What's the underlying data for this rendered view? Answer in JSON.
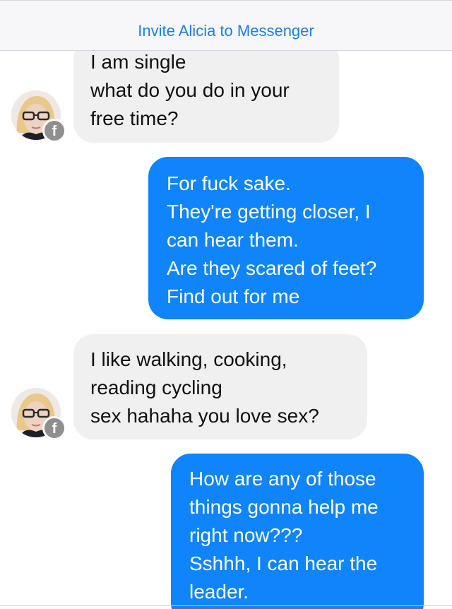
{
  "header": {
    "invite_label": "Invite Alicia to Messenger"
  },
  "messages": [
    {
      "sender": "Alicia",
      "direction": "incoming",
      "lines": [
        "I am single",
        "what do you do in your",
        "free time?"
      ]
    },
    {
      "direction": "outgoing",
      "lines": [
        "For fuck sake.",
        "They're getting closer, I",
        "can hear them.",
        "Are they scared of feet?",
        "Find out for me"
      ]
    },
    {
      "sender": "Alicia",
      "direction": "incoming",
      "lines": [
        "I like walking, cooking,",
        "reading cycling",
        "sex hahaha you love sex?"
      ]
    },
    {
      "direction": "outgoing",
      "lines": [
        "How are any of those",
        "things gonna help me",
        "right now???",
        "Sshhh, I can hear the",
        "leader."
      ]
    }
  ],
  "avatar": {
    "icon": "facebook-badge-icon",
    "badge_glyph": "f"
  },
  "colors": {
    "outgoing_bubble": "#0f84fb",
    "incoming_bubble": "#f0f0f0",
    "link": "#1a7ee9",
    "badge": "#8f8f8f"
  }
}
